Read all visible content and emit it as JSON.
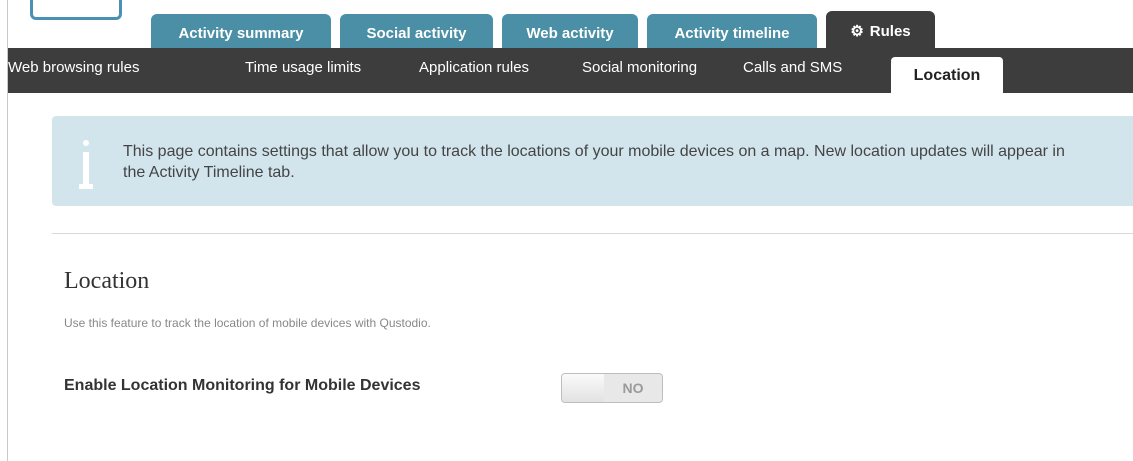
{
  "tabs": [
    {
      "label": "Activity summary"
    },
    {
      "label": "Social activity"
    },
    {
      "label": "Web activity"
    },
    {
      "label": "Activity timeline"
    },
    {
      "label": "Rules",
      "icon": "gear-icon",
      "active": true
    }
  ],
  "subnav": [
    {
      "label": "Web browsing rules"
    },
    {
      "label": "Time usage limits"
    },
    {
      "label": "Application rules"
    },
    {
      "label": "Social monitoring"
    },
    {
      "label": "Calls and SMS"
    },
    {
      "label": "Location",
      "active": true
    }
  ],
  "info": {
    "icon": "info-icon",
    "text": "This page contains settings that allow you to track the locations of your mobile devices on a map. New location updates will appear in the Activity Timeline tab."
  },
  "section": {
    "title": "Location",
    "description": "Use this feature to track the location of mobile devices with Qustodio."
  },
  "setting": {
    "label": "Enable Location Monitoring for Mobile Devices",
    "toggle_state": "NO",
    "enabled": false
  },
  "colors": {
    "tab_blue": "#4a8fa6",
    "nav_dark": "#3d3d3d",
    "info_bg": "#d2e5ed"
  }
}
